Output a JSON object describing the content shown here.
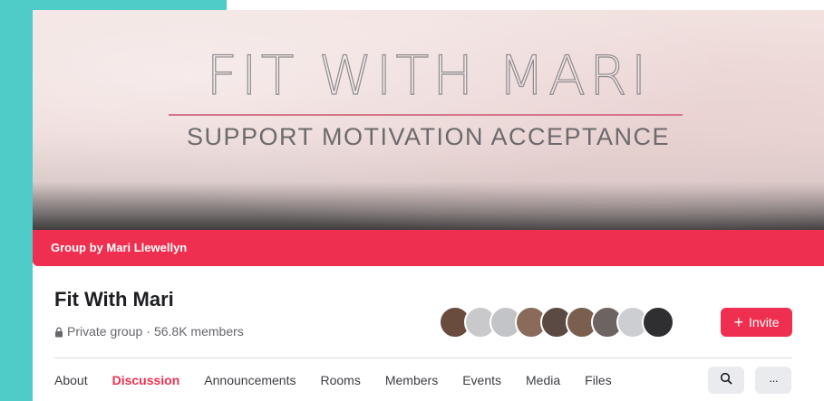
{
  "cover": {
    "title": "FIT WITH MARI",
    "subtitle": "SUPPORT MOTIVATION ACCEPTANCE"
  },
  "group_by": "Group by Mari Llewellyn",
  "group": {
    "name": "Fit With Mari",
    "privacy": "Private group",
    "separator": "·",
    "members": "56.8K members"
  },
  "invite_label": "Invite",
  "tabs": [
    {
      "label": "About"
    },
    {
      "label": "Discussion",
      "active": true
    },
    {
      "label": "Announcements"
    },
    {
      "label": "Rooms"
    },
    {
      "label": "Members"
    },
    {
      "label": "Events"
    },
    {
      "label": "Media"
    },
    {
      "label": "Files"
    }
  ],
  "more_label": "···",
  "icons": {
    "lock": "lock-icon",
    "search": "search-icon",
    "more": "more-icon"
  },
  "colors": {
    "accent": "#ee2f4f",
    "frame": "#4fcbc8",
    "avatars": [
      "#6a4c3e",
      "#c9c9cc",
      "#c3c4c7",
      "#8a6a5a",
      "#5b4a43",
      "#7b5f4e",
      "#6d6361",
      "#cdced1",
      "#2f2e31"
    ]
  }
}
